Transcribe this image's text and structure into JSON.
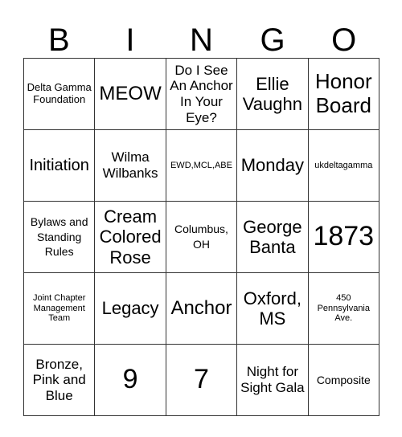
{
  "header": [
    "B",
    "I",
    "N",
    "G",
    "O"
  ],
  "rows": [
    [
      "Delta Gamma Foundation",
      "MEOW",
      "Do I See An Anchor In Your Eye?",
      "Ellie Vaughn",
      "Honor Board"
    ],
    [
      "Initiation",
      "Wilma Wilbanks",
      "EWD,MCL,ABE",
      "Monday",
      "ukdeltagamma"
    ],
    [
      "Bylaws and Standing Rules",
      "Cream Colored Rose",
      "Columbus, OH",
      "George Banta",
      "1873"
    ],
    [
      "Joint Chapter Management Team",
      "Legacy",
      "Anchor",
      "Oxford, MS",
      "450 Pennsylvania Ave."
    ],
    [
      "Bronze, Pink and Blue",
      "9",
      "7",
      "Night for Sight Gala",
      "Composite"
    ]
  ]
}
